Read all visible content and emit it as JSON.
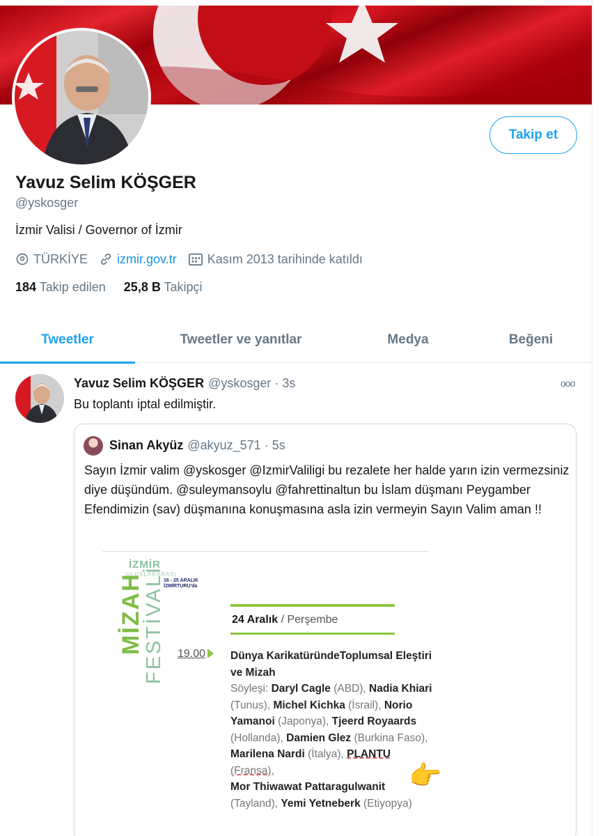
{
  "profile": {
    "name": "Yavuz Selim KÖŞGER",
    "handle": "@yskosger",
    "bio": "İzmir Valisi / Governor of İzmir",
    "location": "TÜRKİYE",
    "website": "izmir.gov.tr",
    "joined": "Kasım 2013 tarihinde katıldı",
    "following_count": "184",
    "following_label": "Takip edilen",
    "followers_count": "25,8 B",
    "followers_label": "Takipçi",
    "follow_button": "Takip et"
  },
  "tabs": [
    {
      "label": "Tweetler",
      "active": true
    },
    {
      "label": "Tweetler ve yanıtlar",
      "active": false
    },
    {
      "label": "Medya",
      "active": false
    },
    {
      "label": "Beğeni",
      "active": false
    }
  ],
  "tweet": {
    "name": "Yavuz Selim KÖŞGER",
    "handle": "@yskosger · 3s",
    "text": "Bu toplantı iptal edilmiştir.",
    "more_icon": "ooo"
  },
  "quote": {
    "name": "Sinan Akyüz",
    "handle": "@akyuz_571 · 5s",
    "text": "Sayın İzmir valim @yskosger @IzmirValiligi bu rezalete her halde yarın izin vermezsiniz diye düşündüm. @suleymansoylu @fahrettinaltun bu İslam düşmanı Peygamber Efendimizin (sav) düşmanına konuşmasına asla izin vermeyin Sayın Valim aman !!"
  },
  "poster": {
    "logo_top": "İZMİR",
    "logo_sub": "ULUSLARARASI",
    "mizah": "MİZAH",
    "festivali": "FESTİVALİ",
    "tag_line1": "16 - 25 ARALIK",
    "tag_line2": "İZMİRTURU'da",
    "date_day": "24 Aralık",
    "date_sep": " / ",
    "date_weekday": "Perşembe",
    "time": "19.00",
    "title": "Dünya KarikatüründeToplumsal Eleştiri ve Mizah",
    "speakers_label": "Söyleşi:",
    "speakers": [
      {
        "name": "Daryl Cagle",
        "country": "(ABD),"
      },
      {
        "name": "Nadia Khiari",
        "country": "(Tunus),"
      },
      {
        "name": "Michel Kichka",
        "country": "(İsrail),"
      },
      {
        "name": "Norio Yamanoi",
        "country": "(Japonya),"
      },
      {
        "name": "Tjeerd Royaards",
        "country": "(Hollanda),"
      },
      {
        "name": "Damien Glez",
        "country": "(Burkina Faso),"
      },
      {
        "name": "Marilena Nardi",
        "country": "(İtalya),"
      },
      {
        "name": "PLANTU",
        "country": "(Fransa),"
      },
      {
        "name": "Mor Thiwawat Pattaragulwanit",
        "country": "(Tayland),"
      },
      {
        "name": "Yemi Yetneberk",
        "country": "(Etiyopya)"
      }
    ]
  },
  "colors": {
    "accent": "#1da1f2",
    "banner_red": "#c8101a",
    "poster_green": "#8cc63f"
  }
}
